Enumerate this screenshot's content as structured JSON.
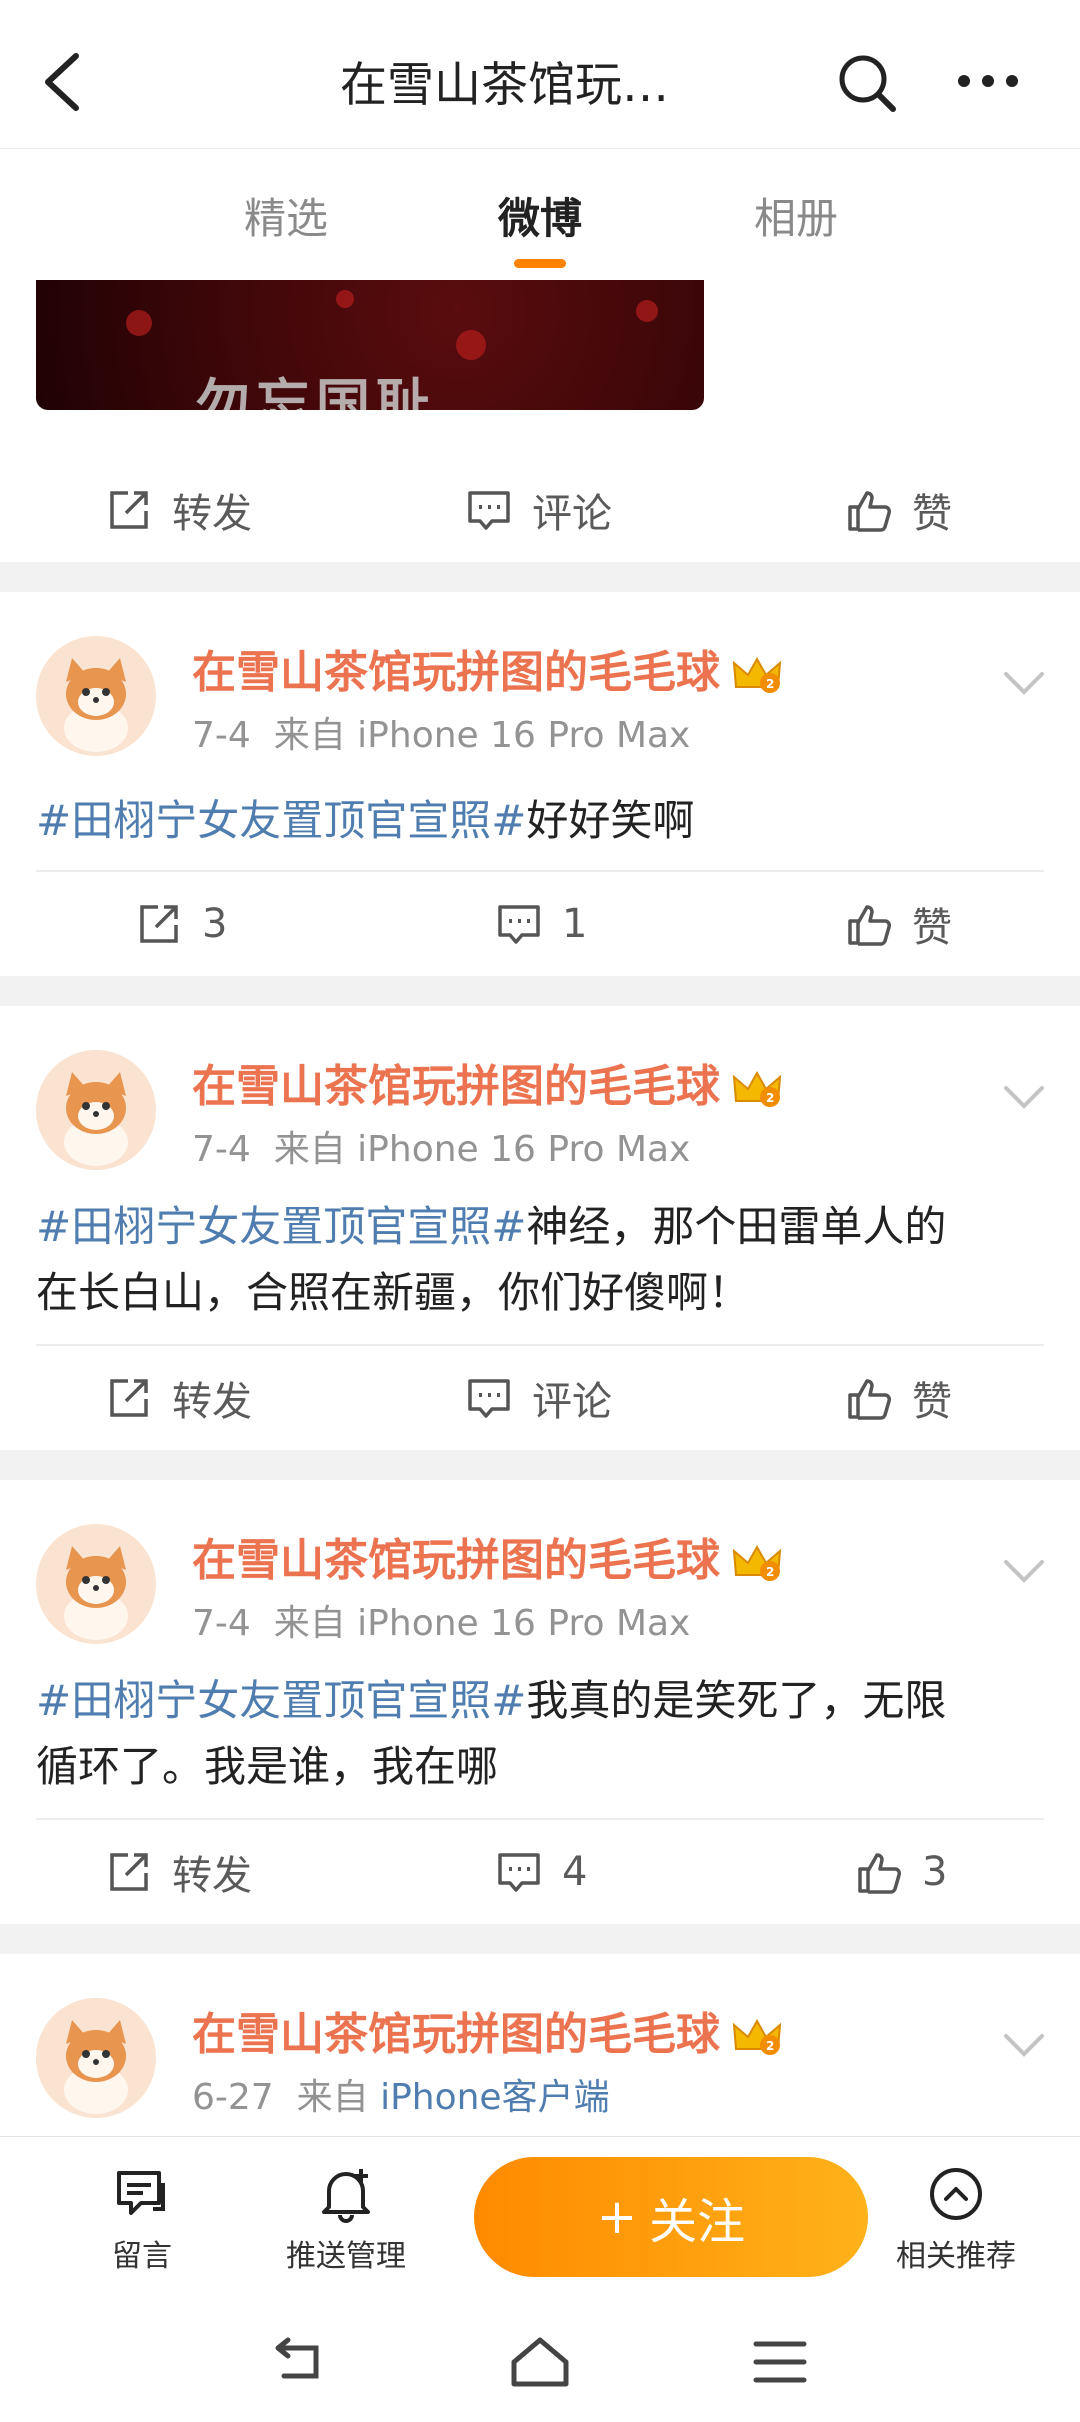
{
  "header": {
    "title": "在雪山茶馆玩…",
    "back_icon": "chevron-left-icon",
    "search_icon": "search-icon",
    "more_icon": "more-dots-icon"
  },
  "tabs": [
    {
      "label": "精选",
      "active": false
    },
    {
      "label": "微博",
      "active": true
    },
    {
      "label": "相册",
      "active": false
    }
  ],
  "first_post_partial": {
    "image_text": "勿忘国耻",
    "actions": {
      "repost": "转发",
      "comment": "评论",
      "like": "赞"
    }
  },
  "posts": [
    {
      "author": "在雪山茶馆玩拼图的毛毛球",
      "date": "7-4",
      "source_prefix": "来自",
      "source": "iPhone 16 Pro Max",
      "topic": "#田栩宁女友置顶官宣照#",
      "text_line1": "好好笑啊",
      "text_line2": "",
      "actions": {
        "repost": "3",
        "comment": "1",
        "like": "赞"
      }
    },
    {
      "author": "在雪山茶馆玩拼图的毛毛球",
      "date": "7-4",
      "source_prefix": "来自",
      "source": "iPhone 16 Pro Max",
      "topic": "#田栩宁女友置顶官宣照#",
      "text_line1": "神经，那个田雷单人的",
      "text_line2": "在长白山，合照在新疆，你们好傻啊！",
      "actions": {
        "repost": "转发",
        "comment": "评论",
        "like": "赞"
      }
    },
    {
      "author": "在雪山茶馆玩拼图的毛毛球",
      "date": "7-4",
      "source_prefix": "来自",
      "source": "iPhone 16 Pro Max",
      "topic": "#田栩宁女友置顶官宣照#",
      "text_line1": "我真的是笑死了，无限",
      "text_line2": "循环了。我是谁，我在哪",
      "actions": {
        "repost": "转发",
        "comment": "4",
        "like": "3"
      }
    },
    {
      "author": "在雪山茶馆玩拼图的毛毛球",
      "date": "6-27",
      "source_prefix": "来自",
      "source": "iPhone客户端"
    }
  ],
  "bottom_bar": {
    "message": "留言",
    "push": "推送管理",
    "follow": "关注",
    "follow_plus": "+",
    "related": "相关推荐"
  },
  "colors": {
    "accent": "#ff8200",
    "author_name": "#eb7350",
    "topic_link": "#507daf"
  }
}
